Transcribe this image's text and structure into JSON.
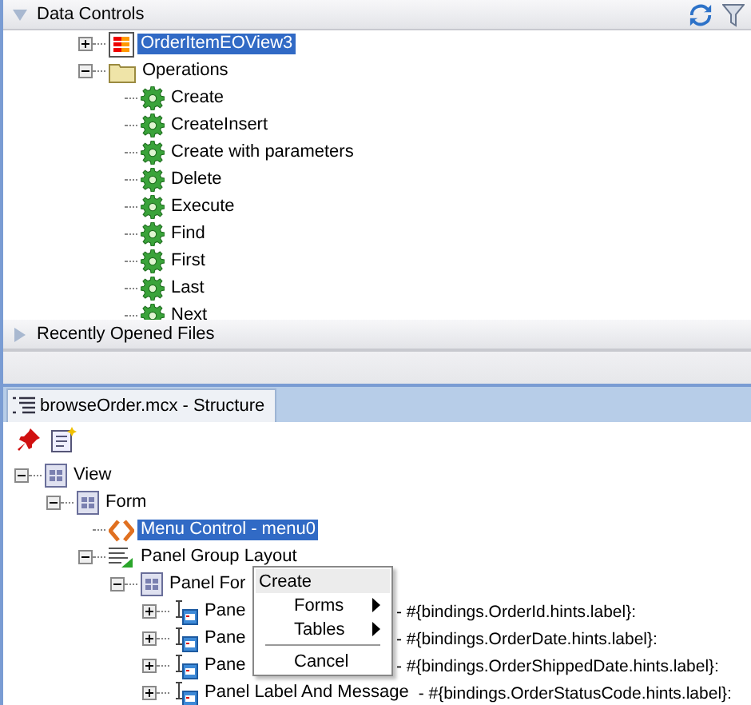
{
  "data_controls": {
    "title": "Data Controls",
    "expanded": true,
    "tree": [
      {
        "label": "OrderItemEOView3",
        "kind": "collection",
        "expanded": false,
        "selected": true
      },
      {
        "label": "Operations",
        "kind": "folder",
        "expanded": true,
        "selected": false,
        "children": [
          {
            "label": "Create",
            "kind": "operation",
            "selected": false
          },
          {
            "label": "CreateInsert",
            "kind": "operation",
            "selected": false
          },
          {
            "label": "Create with parameters",
            "kind": "operation",
            "selected": false
          },
          {
            "label": "Delete",
            "kind": "operation",
            "selected": false
          },
          {
            "label": "Execute",
            "kind": "operation",
            "selected": false
          },
          {
            "label": "Find",
            "kind": "operation",
            "selected": false
          },
          {
            "label": "First",
            "kind": "operation",
            "selected": false
          },
          {
            "label": "Last",
            "kind": "operation",
            "selected": false
          },
          {
            "label": "Next",
            "kind": "operation",
            "selected": false
          }
        ]
      }
    ]
  },
  "recent_files": {
    "title": "Recently Opened Files",
    "expanded": false
  },
  "structure": {
    "tabs": [
      {
        "label": "browseOrder.mcx - Structure",
        "selected": true
      }
    ],
    "tree": [
      {
        "label": "View",
        "kind": "panel",
        "expanded": true,
        "selected": false,
        "children": [
          {
            "label": "Form",
            "kind": "panel",
            "expanded": true,
            "selected": false,
            "children": [
              {
                "label": "Menu Control - menu0",
                "kind": "menu",
                "selected": true
              },
              {
                "label": "Panel Group Layout",
                "kind": "group",
                "expanded": true,
                "selected": false,
                "children": [
                  {
                    "label": "Panel For",
                    "kind": "panel",
                    "expanded": true,
                    "selected": false,
                    "children": [
                      {
                        "label": "Pane",
                        "binding": "- #{bindings.OrderId.hints.label}:",
                        "kind": "field",
                        "expanded": false,
                        "selected": false
                      },
                      {
                        "label": "Pane",
                        "binding": "- #{bindings.OrderDate.hints.label}:",
                        "kind": "field",
                        "expanded": false,
                        "selected": false
                      },
                      {
                        "label": "Pane",
                        "binding": "- #{bindings.OrderShippedDate.hints.label}:",
                        "kind": "field",
                        "expanded": false,
                        "selected": false
                      },
                      {
                        "label": "Panel Label And Message",
                        "binding": "- #{bindings.OrderStatusCode.hints.label}:",
                        "kind": "field",
                        "expanded": false,
                        "selected": false
                      }
                    ]
                  }
                ]
              }
            ]
          }
        ]
      }
    ]
  },
  "context_menu": [
    {
      "label": "Create",
      "kind": "header",
      "selected": true
    },
    {
      "label": "Forms",
      "kind": "submenu",
      "selected": false
    },
    {
      "label": "Tables",
      "kind": "submenu",
      "selected": false
    },
    {
      "kind": "separator"
    },
    {
      "label": "Cancel",
      "kind": "item",
      "selected": false
    }
  ]
}
